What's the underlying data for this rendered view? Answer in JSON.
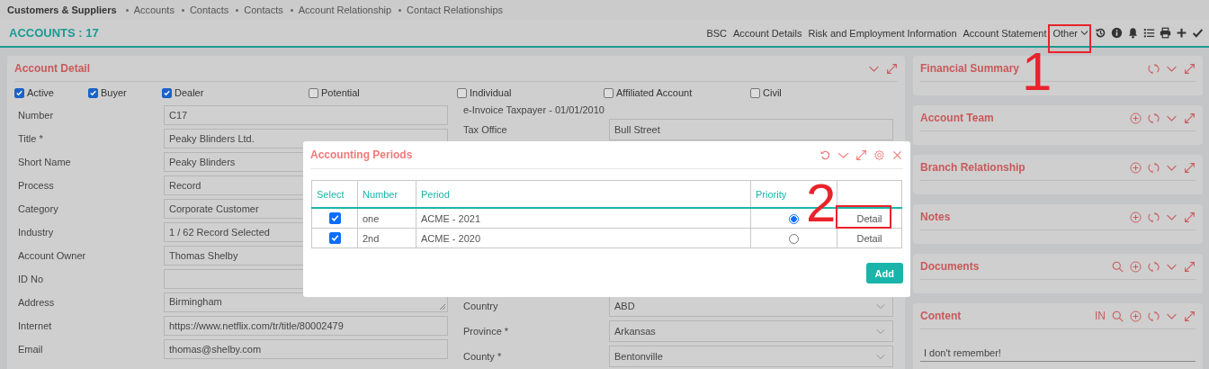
{
  "breadcrumb": {
    "title": "Customers & Suppliers",
    "links": [
      "Accounts",
      "Contacts",
      "Contacts",
      "Account Relationship",
      "Contact Relationships"
    ]
  },
  "header": {
    "title": "ACCOUNTS : 17",
    "menu": [
      "BSC",
      "Account Details",
      "Risk and Employment Information",
      "Account Statement"
    ],
    "dropdown": "Other"
  },
  "account_detail": {
    "title": "Account Detail",
    "flags": [
      {
        "label": "Active",
        "checked": true
      },
      {
        "label": "Buyer",
        "checked": true
      },
      {
        "label": "Dealer",
        "checked": true
      },
      {
        "label": "Potential",
        "checked": false
      },
      {
        "label": "Individual",
        "checked": false
      },
      {
        "label": "Affiliated Account",
        "checked": false
      },
      {
        "label": "Civil",
        "checked": false
      }
    ],
    "left_fields": [
      {
        "label": "Number",
        "value": "C17",
        "kind": "text"
      },
      {
        "label": "Title *",
        "value": "Peaky Blinders Ltd.",
        "kind": "text"
      },
      {
        "label": "Short Name",
        "value": "Peaky Blinders",
        "kind": "text"
      },
      {
        "label": "Process",
        "value": "Record",
        "kind": "text"
      },
      {
        "label": "Category",
        "value": "Corporate Customer",
        "kind": "text"
      },
      {
        "label": "Industry",
        "value": "1 / 62 Record Selected",
        "kind": "text"
      },
      {
        "label": "Account Owner",
        "value": "Thomas Shelby",
        "kind": "text"
      },
      {
        "label": "ID No",
        "kind": "text"
      },
      {
        "label": "Address",
        "value": "Birmingham",
        "kind": "textarea"
      },
      {
        "label": "Internet",
        "value": "https://www.netflix.com/tr/title/80002479",
        "kind": "text"
      },
      {
        "label": "Email",
        "value": "thomas@shelby.com",
        "kind": "text"
      }
    ],
    "right_note": "e-Invoice Taxpayer - 01/01/2010",
    "right_fields_top": [
      {
        "label": "Tax Office",
        "value": "Bull Street",
        "kind": "text"
      }
    ],
    "right_fields_bottom": [
      {
        "label": "Country",
        "value": "ABD",
        "kind": "select"
      },
      {
        "label": "Province *",
        "value": "Arkansas",
        "kind": "select"
      },
      {
        "label": "County *",
        "value": "Bentonville",
        "kind": "select"
      }
    ]
  },
  "side_panels": [
    {
      "title": "Financial Summary",
      "tools": [
        {
          "kind": "refresh"
        },
        {
          "kind": "collapse"
        },
        {
          "kind": "expand"
        }
      ]
    },
    {
      "title": "Account Team",
      "tools": [
        {
          "kind": "add"
        },
        {
          "kind": "refresh"
        },
        {
          "kind": "collapse"
        },
        {
          "kind": "expand"
        }
      ]
    },
    {
      "title": "Branch Relationship",
      "tools": [
        {
          "kind": "add"
        },
        {
          "kind": "refresh"
        },
        {
          "kind": "collapse"
        },
        {
          "kind": "expand"
        }
      ]
    },
    {
      "title": "Notes",
      "tools": [
        {
          "kind": "add"
        },
        {
          "kind": "refresh"
        },
        {
          "kind": "collapse"
        },
        {
          "kind": "expand"
        }
      ]
    },
    {
      "title": "Documents",
      "tools": [
        {
          "kind": "search"
        },
        {
          "kind": "add"
        },
        {
          "kind": "refresh"
        },
        {
          "kind": "collapse"
        },
        {
          "kind": "expand"
        }
      ]
    },
    {
      "title": "Content",
      "tools": [
        {
          "kind": "text",
          "label": "IN"
        },
        {
          "kind": "search"
        },
        {
          "kind": "add"
        },
        {
          "kind": "refresh"
        },
        {
          "kind": "collapse"
        },
        {
          "kind": "expand"
        }
      ],
      "value": "I don't remember!"
    }
  ],
  "dialog": {
    "title": "Accounting Periods",
    "columns": [
      "Select",
      "Number",
      "Period",
      "Priority"
    ],
    "rows": [
      {
        "checked": true,
        "number": "one",
        "period": "ACME - 2021",
        "selected": true,
        "action": "Detail"
      },
      {
        "checked": true,
        "number": "2nd",
        "period": "ACME - 2020",
        "selected": false,
        "action": "Detail"
      }
    ],
    "button": "Add"
  },
  "annotations": [
    {
      "label": "1"
    },
    {
      "label": "2"
    }
  ]
}
